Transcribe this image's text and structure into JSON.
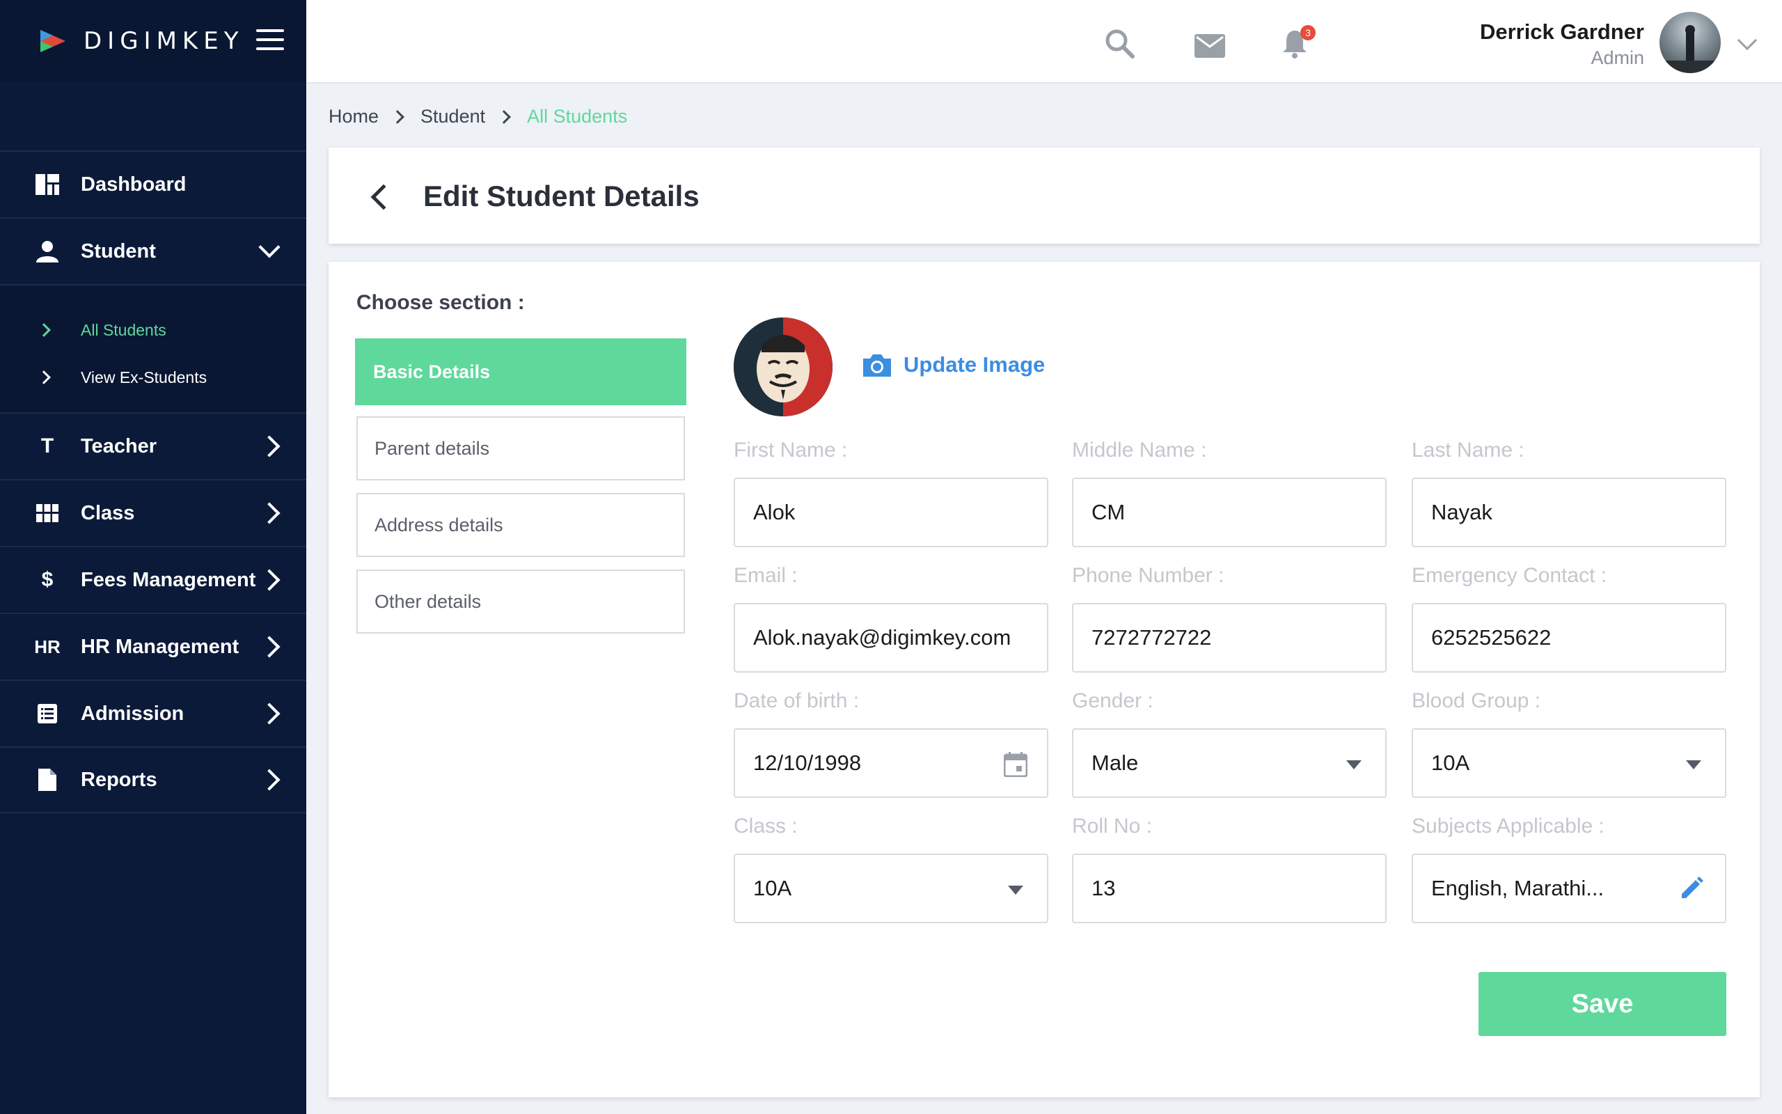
{
  "brand": {
    "name": "DIGIMKEY"
  },
  "sidebar": {
    "items": [
      {
        "label": "Dashboard",
        "icon": "dashboard-icon"
      },
      {
        "label": "Student",
        "icon": "person-icon",
        "expanded": true
      },
      {
        "label": "Teacher",
        "icon": "teacher-icon",
        "glyph": "T"
      },
      {
        "label": "Class",
        "icon": "grid-icon"
      },
      {
        "label": "Fees Management",
        "icon": "dollar-icon",
        "glyph": "$"
      },
      {
        "label": "HR Management",
        "icon": "hr-icon",
        "glyph": "HR"
      },
      {
        "label": "Admission",
        "icon": "list-icon"
      },
      {
        "label": "Reports",
        "icon": "document-icon"
      }
    ],
    "student_sub": [
      {
        "label": "All Students",
        "active": true
      },
      {
        "label": "View Ex-Students",
        "active": false
      }
    ]
  },
  "topbar": {
    "notification_count": "3",
    "user": {
      "name": "Derrick Gardner",
      "role": "Admin"
    }
  },
  "breadcrumb": [
    "Home",
    "Student",
    "All Students"
  ],
  "page": {
    "title": "Edit Student Details"
  },
  "form": {
    "choose_section_label": "Choose section :",
    "sections": [
      "Basic Details",
      "Parent details",
      "Address details",
      "Other details"
    ],
    "update_image_label": "Update Image",
    "fields": {
      "first_name": {
        "label": "First Name :",
        "value": "Alok"
      },
      "middle_name": {
        "label": "Middle Name :",
        "value": "CM"
      },
      "last_name": {
        "label": "Last Name :",
        "value": "Nayak"
      },
      "email": {
        "label": "Email :",
        "value": "Alok.nayak@digimkey.com"
      },
      "phone": {
        "label": "Phone Number :",
        "value": "7272772722"
      },
      "emergency": {
        "label": "Emergency Contact :",
        "value": "6252525622"
      },
      "dob": {
        "label": "Date of birth :",
        "value": "12/10/1998"
      },
      "gender": {
        "label": "Gender :",
        "value": "Male"
      },
      "blood_group": {
        "label": "Blood Group :",
        "value": "10A"
      },
      "class": {
        "label": "Class :",
        "value": "10A"
      },
      "roll_no": {
        "label": "Roll No :",
        "value": "13"
      },
      "subjects": {
        "label": "Subjects Applicable :",
        "value": "English, Marathi..."
      }
    },
    "save_label": "Save"
  },
  "colors": {
    "accent": "#5fd89b",
    "sidebar_bg": "#0c1a3a",
    "link_blue": "#3b8ee0",
    "badge": "#e74c3c"
  }
}
